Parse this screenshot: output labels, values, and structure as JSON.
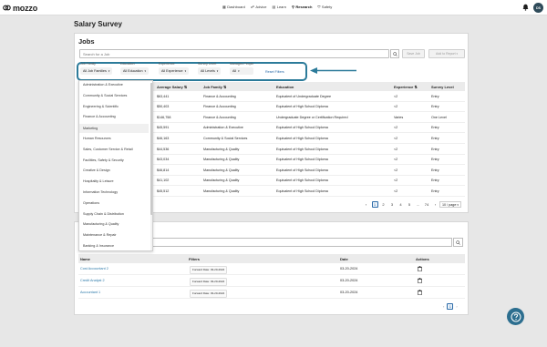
{
  "app": {
    "logo": "mozzo",
    "brand_color": "#1d1d1d",
    "accent": "#2c7b9a"
  },
  "nav": {
    "items": [
      {
        "label": "Dashboard",
        "icon": "dashboard-icon"
      },
      {
        "label": "Advice",
        "icon": "advice-icon"
      },
      {
        "label": "Learn",
        "icon": "learn-icon"
      },
      {
        "label": "Research",
        "icon": "research-icon",
        "active": true
      },
      {
        "label": "Safety",
        "icon": "safety-icon"
      }
    ],
    "avatar_initials": "DS"
  },
  "page": {
    "title": "Salary Survey"
  },
  "jobs": {
    "title": "Jobs",
    "search_placeholder": "Search for a Job",
    "save_job": "Save Job",
    "add_to_report": "Add to Report",
    "filters": [
      {
        "label": "Job Family",
        "value": "All Job Families"
      },
      {
        "label": "Education",
        "value": "All Education"
      },
      {
        "label": "Experience",
        "value": "All Experience"
      },
      {
        "label": "Survey Level",
        "value": "All Levels"
      },
      {
        "label": "Manages People",
        "value": "All"
      }
    ],
    "reset": "Reset Filters",
    "columns": [
      "Average Salary",
      "Job Family",
      "Education",
      "Experience",
      "Survey Level"
    ],
    "rows": [
      {
        "salary": "$63,441",
        "family": "Finance & Accounting",
        "education": "Equivalent of Undergraduate Degree",
        "experience": "<2",
        "level": "Entry"
      },
      {
        "salary": "$50,403",
        "family": "Finance & Accounting",
        "education": "Equivalent of High School Diploma",
        "experience": "<2",
        "level": "Entry"
      },
      {
        "salary": "$146,758",
        "family": "Finance & Accounting",
        "education": "Undergraduate Degree or Certification Required",
        "experience": "Varies",
        "level": "One Level"
      },
      {
        "salary": "$45,591",
        "family": "Administration & Executive",
        "education": "Equivalent of High School Diploma",
        "experience": "<2",
        "level": "Entry"
      },
      {
        "salary": "$46,163",
        "family": "Community & Social Services",
        "education": "Equivalent of High School Diploma",
        "experience": "<2",
        "level": "Entry"
      },
      {
        "salary": "$44,536",
        "family": "Manufacturing & Quality",
        "education": "Equivalent of High School Diploma",
        "experience": "<2",
        "level": "Entry"
      },
      {
        "salary": "$43,034",
        "family": "Manufacturing & Quality",
        "education": "Equivalent of High School Diploma",
        "experience": "<2",
        "level": "Entry"
      },
      {
        "salary": "$46,814",
        "family": "Manufacturing & Quality",
        "education": "Equivalent of High School Diploma",
        "experience": "<2",
        "level": "Entry"
      },
      {
        "salary": "$41,102",
        "family": "Manufacturing & Quality",
        "education": "Equivalent of High School Diploma",
        "experience": "<2",
        "level": "Entry"
      },
      {
        "salary": "$45,512",
        "family": "Manufacturing & Quality",
        "education": "Equivalent of High School Diploma",
        "experience": "<2",
        "level": "Entry"
      }
    ],
    "pagination": {
      "prev": "‹",
      "pages": [
        "1",
        "2",
        "3",
        "4",
        "5",
        "...",
        "74"
      ],
      "next": "›",
      "per_page": "10 / page"
    }
  },
  "job_family_dropdown": {
    "options": [
      "Administration & Executive",
      "Community & Social Services",
      "Engineering & Scientific",
      "Finance & Accounting",
      "Marketing",
      "Human Resources",
      "Sales, Customer Service & Retail",
      "Facilities, Safety & Security",
      "Creative & Design",
      "Hospitality & Leisure",
      "Information Technology",
      "Operations",
      "Supply Chain & Distribution",
      "Manufacturing & Quality",
      "Maintenance & Repair",
      "Banking & Insurance"
    ],
    "highlighted": "Marketing"
  },
  "reports": {
    "columns": [
      "Name",
      "Filters",
      "Date",
      "Actions"
    ],
    "rows": [
      {
        "name": "Cost Accountant 2",
        "filter": "Forward Date: 03-20-2024",
        "date": "03-20-2024"
      },
      {
        "name": "Credit Analyst 2",
        "filter": "Forward Date: 03-20-2024",
        "date": "03-20-2024"
      },
      {
        "name": "Accountant 1",
        "filter": "Forward Date: 03-20-2024",
        "date": "03-20-2024"
      }
    ],
    "pagination": {
      "prev": "‹",
      "page": "1",
      "next": "›"
    }
  }
}
